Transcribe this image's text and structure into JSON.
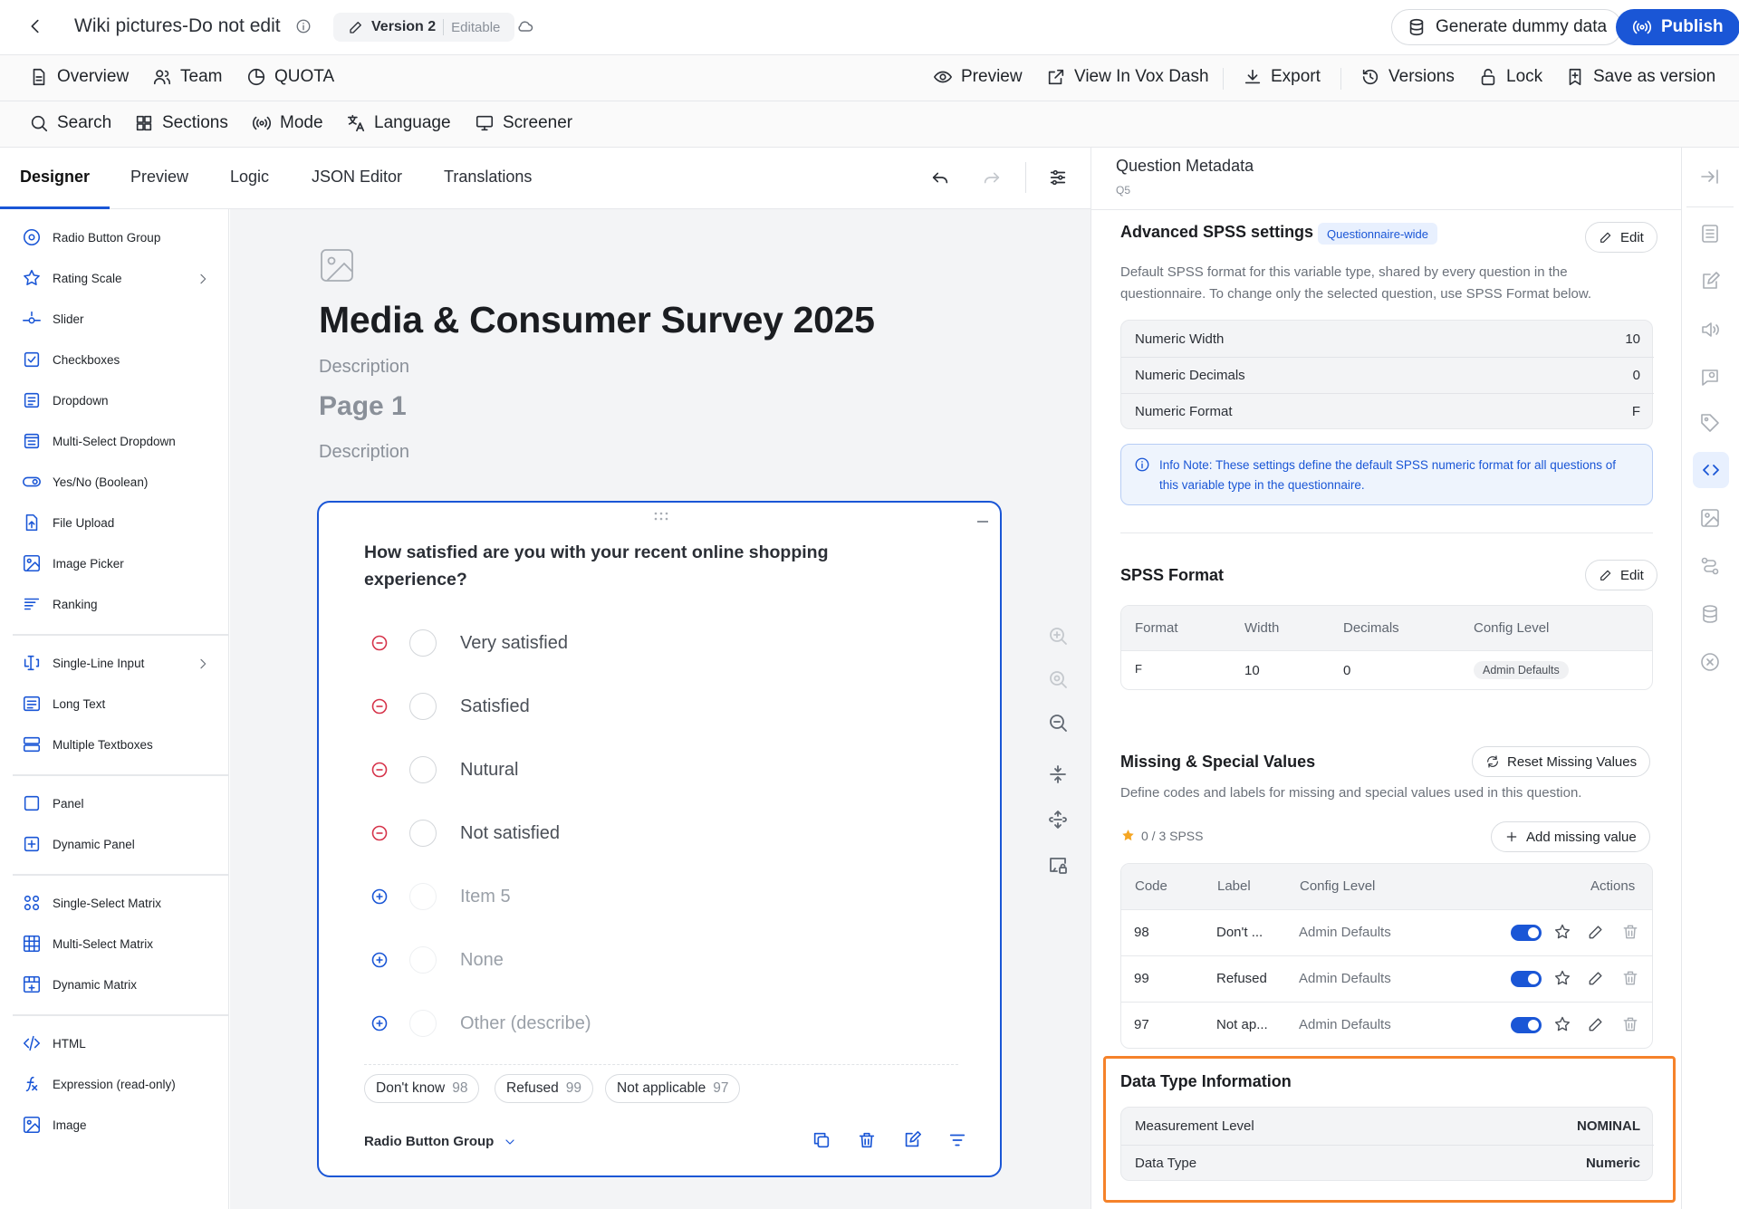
{
  "header": {
    "title": "Wiki pictures-Do not edit",
    "version": "Version 2",
    "version_state": "Editable",
    "generate_label": "Generate dummy data",
    "publish_label": "Publish"
  },
  "nav": {
    "overview": "Overview",
    "team": "Team",
    "quota": "QUOTA",
    "preview": "Preview",
    "view_vox": "View In Vox Dash",
    "export": "Export",
    "versions": "Versions",
    "lock": "Lock",
    "save_version": "Save as version"
  },
  "tools": {
    "search": "Search",
    "sections": "Sections",
    "mode": "Mode",
    "language": "Language",
    "screener": "Screener"
  },
  "designer_tabs": [
    "Designer",
    "Preview",
    "Logic",
    "JSON Editor",
    "Translations"
  ],
  "toolbox": {
    "items": [
      {
        "label": "Radio Button Group",
        "icon": "radio-icon"
      },
      {
        "label": "Rating Scale",
        "icon": "star-icon"
      },
      {
        "label": "Slider",
        "icon": "slider-icon"
      },
      {
        "label": "Checkboxes",
        "icon": "checkbox-icon"
      },
      {
        "label": "Dropdown",
        "icon": "dropdown-icon"
      },
      {
        "label": "Multi-Select Dropdown",
        "icon": "multi-dropdown-icon"
      },
      {
        "label": "Yes/No (Boolean)",
        "icon": "toggle-icon"
      },
      {
        "label": "File Upload",
        "icon": "file-upload-icon"
      },
      {
        "label": "Image Picker",
        "icon": "image-picker-icon"
      },
      {
        "label": "Ranking",
        "icon": "ranking-icon"
      },
      {
        "label": "Single-Line Input",
        "icon": "text-input-icon"
      },
      {
        "label": "Long Text",
        "icon": "long-text-icon"
      },
      {
        "label": "Multiple Textboxes",
        "icon": "multi-text-icon"
      },
      {
        "label": "Panel",
        "icon": "panel-icon"
      },
      {
        "label": "Dynamic Panel",
        "icon": "dynamic-panel-icon"
      },
      {
        "label": "Single-Select Matrix",
        "icon": "matrix-icon"
      },
      {
        "label": "Multi-Select Matrix",
        "icon": "grid-icon"
      },
      {
        "label": "Dynamic Matrix",
        "icon": "dynamic-matrix-icon"
      },
      {
        "label": "HTML",
        "icon": "code-icon"
      },
      {
        "label": "Expression (read-only)",
        "icon": "function-icon"
      },
      {
        "label": "Image",
        "icon": "image-icon"
      }
    ]
  },
  "survey": {
    "title": "Media & Consumer Survey 2025",
    "description": "Description",
    "page_title": "Page 1",
    "page_description": "Description",
    "question": {
      "text": "How satisfied are you with your recent online shopping experience?",
      "choices": [
        "Very satisfied",
        "Satisfied",
        "Nutural",
        "Not satisfied"
      ],
      "add_choices": [
        "Item 5",
        "None",
        "Other (describe)"
      ],
      "chips": [
        {
          "label": "Don't know",
          "code": "98"
        },
        {
          "label": "Refused",
          "code": "99"
        },
        {
          "label": "Not applicable",
          "code": "97"
        }
      ],
      "type_label": "Radio Button Group"
    }
  },
  "panel": {
    "title": "Question Metadata",
    "subtitle": "Q5",
    "advanced": {
      "title": "Advanced SPSS settings",
      "badge": "Questionnaire-wide",
      "edit_label": "Edit",
      "help": "Default SPSS format for this variable type, shared by every question in the questionnaire. To change only the selected question, use SPSS Format below.",
      "rows": [
        {
          "label": "Numeric Width",
          "value": "10"
        },
        {
          "label": "Numeric Decimals",
          "value": "0"
        },
        {
          "label": "Numeric Format",
          "value": "F"
        }
      ],
      "note": "Info Note: These settings define the default SPSS numeric format for all questions of this variable type in the questionnaire."
    },
    "spss_format": {
      "title": "SPSS Format",
      "edit_label": "Edit",
      "headers": [
        "Format",
        "Width",
        "Decimals",
        "Config Level"
      ],
      "row": {
        "format": "F",
        "width": "10",
        "decimals": "0",
        "config": "Admin Defaults"
      }
    },
    "missing": {
      "title": "Missing & Special Values",
      "reset_label": "Reset Missing Values",
      "help": "Define codes and labels for missing and special values used in this question.",
      "count": "0 / 3 SPSS",
      "add_label": "Add missing value",
      "headers": [
        "Code",
        "Label",
        "Config Level",
        "Actions"
      ],
      "rows": [
        {
          "code": "98",
          "label": "Don't ...",
          "config": "Admin Defaults",
          "enabled": true
        },
        {
          "code": "99",
          "label": "Refused",
          "config": "Admin Defaults",
          "enabled": true
        },
        {
          "code": "97",
          "label": "Not ap...",
          "config": "Admin Defaults",
          "enabled": true
        }
      ]
    },
    "data_type": {
      "title": "Data Type Information",
      "rows": [
        {
          "label": "Measurement Level",
          "value": "NOMINAL"
        },
        {
          "label": "Data Type",
          "value": "Numeric"
        }
      ]
    }
  },
  "colors": {
    "accent": "#1a56d6",
    "remove": "#d6334a",
    "highlight": "#f5822a"
  }
}
